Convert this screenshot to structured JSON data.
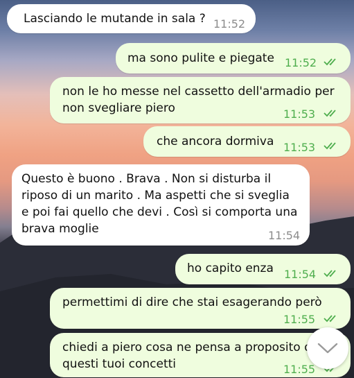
{
  "messages": [
    {
      "text": "Lasciando le mutande in sala ?",
      "time": "11:52",
      "direction": "incoming"
    },
    {
      "text": "ma sono pulite e piegate",
      "time": "11:52",
      "direction": "outgoing",
      "status": "read"
    },
    {
      "lines": [
        "non le ho messe nel cassetto dell'armadio per",
        "non svegliare piero"
      ],
      "time": "11:53",
      "direction": "outgoing",
      "status": "read"
    },
    {
      "text": "che ancora dormiva",
      "time": "11:53",
      "direction": "outgoing",
      "status": "read"
    },
    {
      "lines": [
        "Questo è buono . Brava . Non si disturba il",
        "riposo di un marito . Ma aspetti che si sveglia",
        "e poi fai quello che devi . Così si comporta una",
        "brava moglie"
      ],
      "time": "11:54",
      "direction": "incoming"
    },
    {
      "text": "ho capito enza",
      "time": "11:54",
      "direction": "outgoing",
      "status": "read"
    },
    {
      "text": "permettimi di dire che stai esagerando però",
      "time": "11:55",
      "direction": "outgoing",
      "status": "read"
    },
    {
      "lines": [
        "chiedi a piero cosa ne pensa a proposito di",
        "questi tuoi concetti"
      ],
      "time": "11:55",
      "direction": "outgoing",
      "status": "read"
    }
  ],
  "icons": {
    "read_receipt": "double-check-icon",
    "scroll_down": "chevron-down-icon"
  },
  "colors": {
    "incoming_bubble": "#ffffff",
    "outgoing_bubble": "#effdde",
    "outgoing_time": "#4fae4e",
    "incoming_time": "#8c8c8c"
  }
}
